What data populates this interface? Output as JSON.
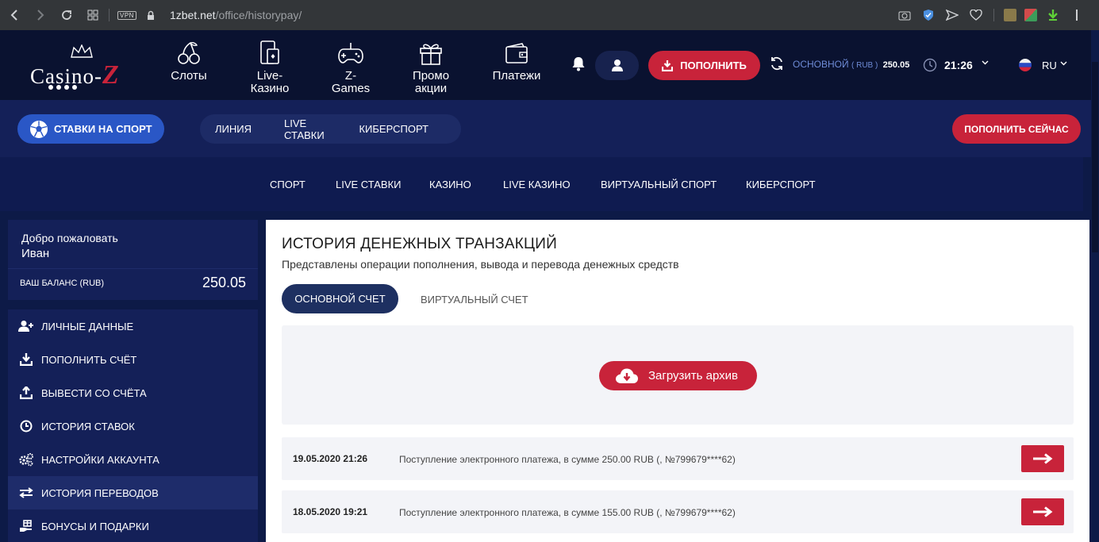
{
  "browser": {
    "vpn": "VPN",
    "url_host": "1zbet.net",
    "url_path": "/office/historypay/"
  },
  "header": {
    "logo": {
      "part1": "Casino-",
      "part2": "Z"
    },
    "nav": [
      {
        "label": "Слоты",
        "icon": "cherry-icon"
      },
      {
        "label": "Live-\nКазино",
        "icon": "phone-card-icon"
      },
      {
        "label": "Z-\nGames",
        "icon": "gamepad-icon"
      },
      {
        "label": "Промо\nакции",
        "icon": "gift-icon"
      },
      {
        "label": "Платежи",
        "icon": "wallet-icon"
      }
    ],
    "topup_label": "ПОПОЛНИТЬ",
    "balance_label": "ОСНОВНОЙ",
    "balance_currency": "( RUB )",
    "balance_amount": "250.05",
    "time": "21:26",
    "language": "RU"
  },
  "subheader": {
    "sport_button": "СТАВКИ НА СПОРТ",
    "pill_nav": [
      "ЛИНИЯ",
      "LIVE СТАВКИ",
      "КИБЕРСПОРТ"
    ],
    "topup_now": "ПОПОЛНИТЬ СЕЙЧАС"
  },
  "third_nav": [
    "СПОРТ",
    "LIVE СТАВКИ",
    "КАЗИНО",
    "LIVE КАЗИНО",
    "ВИРТУАЛЬНЫЙ СПОРТ",
    "КИБЕРСПОРТ"
  ],
  "sidebar": {
    "welcome": "Добро пожаловать",
    "user_name": "Иван",
    "balance_label": "ВАШ БАЛАНС (RUB)",
    "balance_value": "250.05",
    "items": [
      {
        "label": "ЛИЧНЫЕ ДАННЫЕ",
        "icon": "user-add-icon"
      },
      {
        "label": "ПОПОЛНИТЬ СЧЁТ",
        "icon": "download-icon"
      },
      {
        "label": "ВЫВЕСТИ СО СЧЁТА",
        "icon": "upload-icon"
      },
      {
        "label": "ИСТОРИЯ СТАВОК",
        "icon": "clock-icon"
      },
      {
        "label": "НАСТРОЙКИ АККАУНТА",
        "icon": "gears-icon"
      },
      {
        "label": "ИСТОРИЯ ПЕРЕВОДОВ",
        "icon": "transfer-arrows-icon",
        "active": true
      },
      {
        "label": "БОНУСЫ И ПОДАРКИ",
        "icon": "hand-gift-icon"
      }
    ]
  },
  "content": {
    "title": "ИСТОРИЯ ДЕНЕЖНЫХ ТРАНЗАКЦИЙ",
    "subtitle": "Представлены операции пополнения, вывода и перевода денежных средств",
    "tabs": [
      "ОСНОВНОЙ СЧЕТ",
      "ВИРТУАЛЬНЫЙ СЧЕТ"
    ],
    "archive_button": "Загрузить архив",
    "transactions": [
      {
        "date": "19.05.2020 21:26",
        "description": "Поступление электронного платежа, в сумме 250.00 RUB (, №799679****62)"
      },
      {
        "date": "18.05.2020 19:21",
        "description": "Поступление электронного платежа, в сумме 155.00 RUB (, №799679****62)"
      }
    ]
  },
  "colors": {
    "accent_red": "#c8233a",
    "sport_blue": "#2a57c6",
    "dark_navy": "#0a1230",
    "panel_navy": "#142058"
  }
}
